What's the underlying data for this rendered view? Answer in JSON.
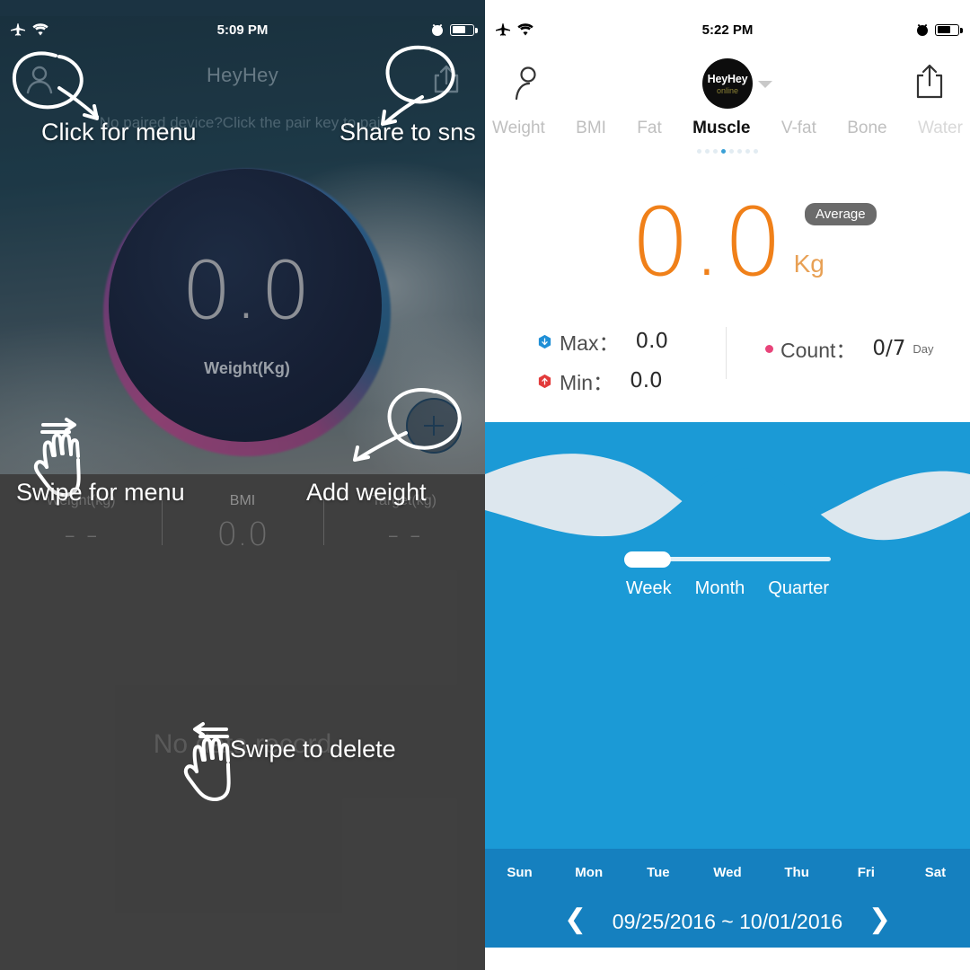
{
  "left": {
    "status": {
      "time": "5:09 PM",
      "airplane_icon": "airplane-icon",
      "wifi_icon": "wifi-icon",
      "alarm_icon": "alarm-icon",
      "battery_icon": "battery-icon",
      "battery_level": 62
    },
    "nav": {
      "title": "HeyHey",
      "profile_icon": "profile-icon",
      "share_icon": "share-icon"
    },
    "hint": "No paired device?Click the pair key to pair",
    "dial": {
      "value": "0.0",
      "unit": "Weight(Kg)"
    },
    "add_button": {
      "icon": "plus-icon"
    },
    "stats": [
      {
        "label": "Weight(kg)",
        "value": "- -"
      },
      {
        "label": "BMI",
        "value": "0.0"
      },
      {
        "label": "Target(kg)",
        "value": "- -"
      }
    ],
    "empty_text": "No data record",
    "annotations": [
      {
        "name": "click-for-menu",
        "text": "Click for menu"
      },
      {
        "name": "share-to-sns",
        "text": "Share to sns"
      },
      {
        "name": "swipe-for-menu",
        "text": "Swipe for menu"
      },
      {
        "name": "add-weight",
        "text": "Add weight"
      },
      {
        "name": "swipe-to-delete",
        "text": "Swipe to delete"
      }
    ]
  },
  "right": {
    "status": {
      "time": "5:22 PM",
      "airplane_icon": "airplane-icon",
      "wifi_icon": "wifi-icon",
      "alarm_icon": "alarm-icon",
      "battery_icon": "battery-icon",
      "battery_level": 62
    },
    "nav": {
      "profile_icon": "profile-icon",
      "share_icon": "share-icon"
    },
    "avatar": {
      "name": "HeyHey",
      "status": "online",
      "caret_icon": "chevron-down-icon"
    },
    "tabs": [
      {
        "label": "Weight",
        "active": false,
        "faded": false
      },
      {
        "label": "BMI",
        "active": false,
        "faded": false
      },
      {
        "label": "Fat",
        "active": false,
        "faded": false
      },
      {
        "label": "Muscle",
        "active": true,
        "faded": false
      },
      {
        "label": "V-fat",
        "active": false,
        "faded": false
      },
      {
        "label": "Bone",
        "active": false,
        "faded": false
      },
      {
        "label": "Water",
        "active": false,
        "faded": true
      }
    ],
    "page_dots": {
      "count": 8,
      "active_index": 3
    },
    "reading": {
      "value": "0.0",
      "unit": "Kg",
      "badge": "Average"
    },
    "stats": {
      "max": {
        "label": "Max：",
        "value": "0.0",
        "icon": "hexagon-down-icon",
        "color": "#1f8fd6"
      },
      "min": {
        "label": "Min：",
        "value": "0.0",
        "icon": "hexagon-up-icon",
        "color": "#e23b3b"
      },
      "count": {
        "label": "Count：",
        "value": "0/7",
        "suffix": "Day",
        "icon": "dot-icon",
        "color": "#e8447a"
      }
    },
    "range_slider": {
      "options": [
        "Week",
        "Month",
        "Quarter"
      ],
      "selected": "Week"
    },
    "weekdays": [
      "Sun",
      "Mon",
      "Tue",
      "Wed",
      "Thu",
      "Fri",
      "Sat"
    ],
    "date_range": "09/25/2016 ~ 10/01/2016",
    "prev_icon": "chevron-left-icon",
    "next_icon": "chevron-right-icon",
    "colors": {
      "water": "#1b9ad6",
      "water_back": "#dde7ee",
      "bar": "#1580bf",
      "accent": "#f08019"
    }
  }
}
